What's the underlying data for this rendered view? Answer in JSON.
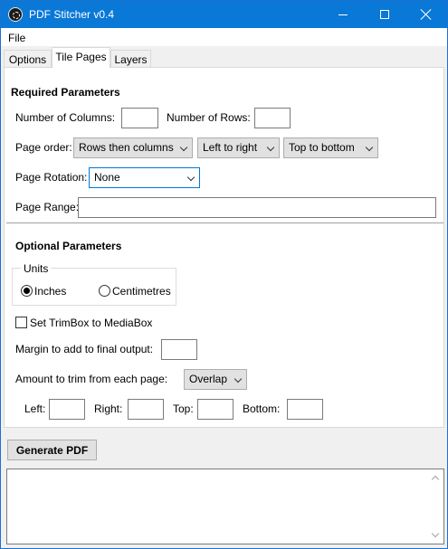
{
  "window": {
    "title": "PDF Stitcher v0.4"
  },
  "menu": {
    "file": "File"
  },
  "tabs": [
    "Options",
    "Tile Pages",
    "Layers"
  ],
  "active_tab": "Tile Pages",
  "required": {
    "title": "Required Parameters",
    "columns_label": "Number of Columns:",
    "columns_value": "",
    "rows_label": "Number of Rows:",
    "rows_value": "",
    "page_order_label": "Page order:",
    "page_order": [
      "Rows then columns",
      "Left to right",
      "Top to bottom"
    ],
    "rotation_label": "Page Rotation:",
    "rotation_value": "None",
    "range_label": "Page Range:",
    "range_value": ""
  },
  "optional": {
    "title": "Optional Parameters",
    "units_label": "Units",
    "units_options": [
      "Inches",
      "Centimetres"
    ],
    "units_selected": "Inches",
    "trimbox_label": "Set TrimBox to MediaBox",
    "trimbox_checked": false,
    "margin_label": "Margin to add to final output:",
    "margin_value": "",
    "trim_label": "Amount to trim from each page:",
    "trim_mode": "Overlap",
    "left_label": "Left:",
    "right_label": "Right:",
    "top_label": "Top:",
    "bottom_label": "Bottom:"
  },
  "actions": {
    "generate": "Generate PDF"
  },
  "log": {
    "text": ""
  },
  "colors": {
    "titlebar": "#0a78d7",
    "focus": "#0078d7"
  }
}
